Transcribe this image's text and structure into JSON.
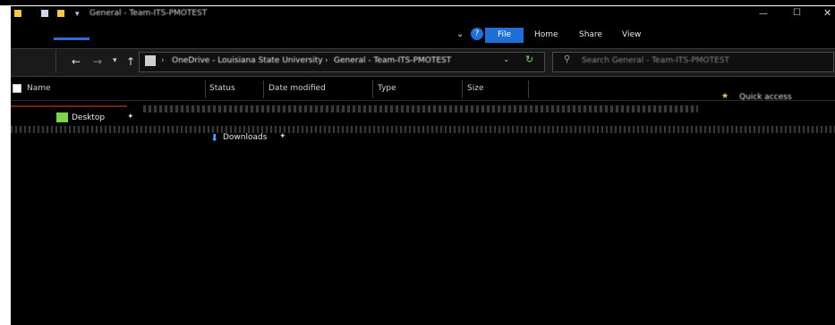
{
  "window": {
    "title": "General - Team-ITS-PMOTEST"
  },
  "ribbon": {
    "file_label": "File",
    "home_label": "Home",
    "share_label": "Share",
    "view_label": "View"
  },
  "address": {
    "crumbs": [
      "OneDrive - Louisiana State University",
      "General - Team-ITS-PMOTEST"
    ]
  },
  "search": {
    "placeholder": "Search General - Team-ITS-PMOTEST"
  },
  "columns": {
    "name": "Name",
    "status": "Status",
    "date_modified": "Date modified",
    "type": "Type",
    "size": "Size"
  },
  "nav": {
    "quick_access": "Quick access",
    "desktop": "Desktop",
    "downloads": "Downloads"
  }
}
